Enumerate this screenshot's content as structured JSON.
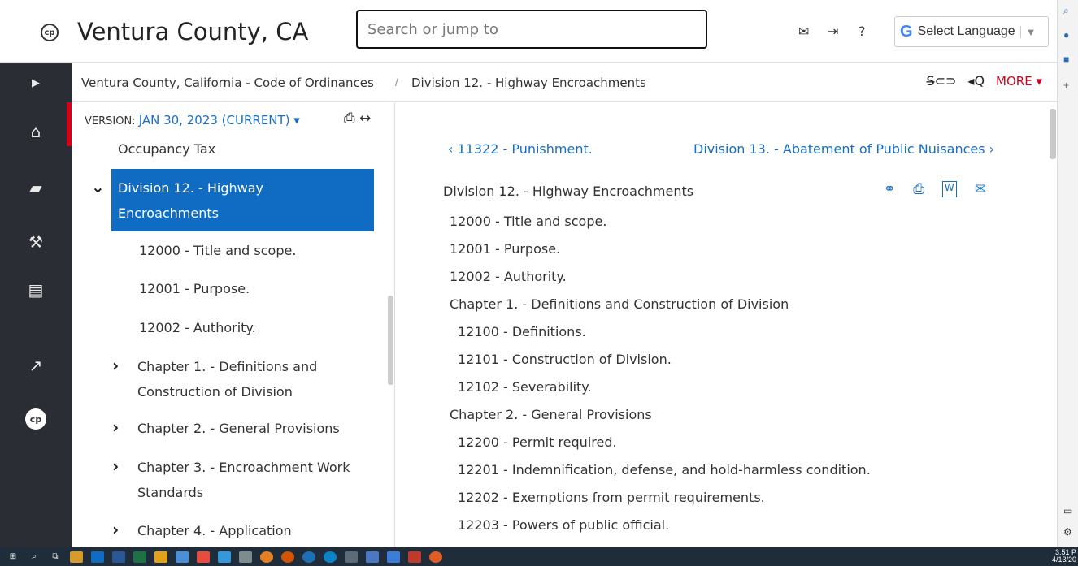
{
  "header": {
    "logo_text": "cp",
    "title": "Ventura County, CA",
    "search_placeholder": "Search or jump to",
    "language_label": "Select Language",
    "language_arrow": "▼",
    "google_g": "G"
  },
  "breadcrumb": {
    "root": "Ventura County, California - Code of Ordinances",
    "separator": "/",
    "current": "Division 12. - Highway Encroachments",
    "tool_compare": "S̶⊂⊃",
    "tool_search": "◂Q",
    "more_label": "MORE ▾"
  },
  "rail": {
    "items": [
      {
        "name": "expand",
        "glyph": "▶"
      },
      {
        "name": "home",
        "glyph": "⌂"
      },
      {
        "name": "codes",
        "glyph": "▰"
      },
      {
        "name": "legislation",
        "glyph": "⚒"
      },
      {
        "name": "documents",
        "glyph": "▤"
      },
      {
        "name": "external",
        "glyph": "↗"
      },
      {
        "name": "munipro",
        "glyph": "cp"
      }
    ]
  },
  "toc": {
    "version_prefix": "VERSION: ",
    "version_value": "JAN 30, 2023 (CURRENT) ▾",
    "tools_glyph": "⎙ ↔",
    "item_occupancy": "Occupancy Tax",
    "active_item": "Division 12. - Highway Encroachments",
    "expanded_glyph": "⌄",
    "collapsed_glyph": "›",
    "sections": [
      "12000 - Title and scope.",
      "12001 - Purpose.",
      "12002 - Authority."
    ],
    "chapters": [
      "Chapter 1. - Definitions and Construction of Division",
      "Chapter 2. - General Provisions",
      "Chapter 3. - Encroachment Work Standards",
      "Chapter 4. - Application"
    ]
  },
  "main": {
    "prev_link": "‹  11322 - Punishment.",
    "next_link": "Division 13. - Abatement of Public Nuisances  ›",
    "doc_title": "Division 12. - Highway Encroachments",
    "tools": [
      "⚭",
      "⎙",
      "W",
      "✉"
    ],
    "lines": [
      "12000 - Title and scope.",
      "12001 - Purpose.",
      "12002 - Authority.",
      "Chapter 1. - Definitions and Construction of Division",
      "12100 - Definitions.",
      "12101 - Construction of Division.",
      "12102 - Severability.",
      "Chapter 2. - General Provisions",
      "12200 - Permit required.",
      "12201 - Indemnification, defense, and hold-harmless condition.",
      "12202 - Exemptions from permit requirements.",
      "12203 - Powers of public official."
    ]
  },
  "taskbar": {
    "clock_time": "3:51 P",
    "clock_date": "4/13/20"
  },
  "colors": {
    "accent": "#0f6cc2",
    "link": "#1a6fc4",
    "more": "#d0021b",
    "rail": "#2a2d33"
  }
}
